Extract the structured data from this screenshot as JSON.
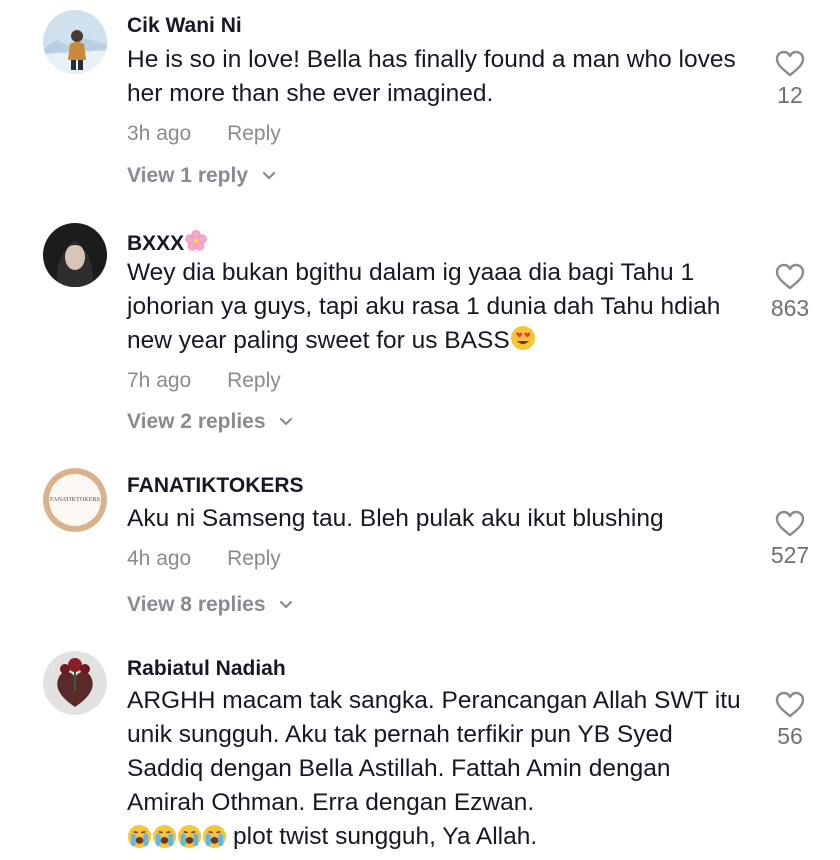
{
  "colors": {
    "text": "#161823",
    "muted": "#8a8b91",
    "count": "#6f7076"
  },
  "comments": [
    {
      "username": "Cik Wani Ni",
      "text": "He is so in love! Bella has finally found a man who loves her more than she ever imagined.",
      "time": "3h ago",
      "reply_label": "Reply",
      "view_replies": "View 1 reply",
      "likes": "12",
      "avatar_icon": "snow-photo-avatar"
    },
    {
      "username": "BXXX",
      "username_emoji": "cherry-blossom-emoji",
      "text": "Wey dia bukan bgithu dalam ig yaaa dia bagi Tahu 1 johorian ya guys, tapi aku rasa 1 dunia dah Tahu hdiah new year paling sweet for us BASS",
      "text_emoji": "heart-eyes-emoji",
      "time": "7h ago",
      "reply_label": "Reply",
      "view_replies": "View 2 replies",
      "likes": "863",
      "avatar_icon": "dark-hooded-avatar"
    },
    {
      "username": "FANATIKTOKERS",
      "text": "Aku ni Samseng tau. Bleh pulak aku ikut blushing",
      "time": "4h ago",
      "reply_label": "Reply",
      "view_replies": "View 8 replies",
      "likes": "527",
      "avatar_text": "FANATIKTOKERS"
    },
    {
      "username": "Rabiatul Nadiah",
      "text": "ARGHH macam tak sangka. Perancangan Allah SWT itu unik sungguh. Aku tak pernah terfikir pun YB Syed Saddiq dengan Bella Astillah. Fattah Amin dengan Amirah Othman. Erra dengan Ezwan.",
      "text_line2": "plot twist sungguh, Ya Allah.",
      "text_emoji": "crying-face-emoji",
      "likes": "56",
      "avatar_icon": "rose-heart-avatar"
    }
  ]
}
